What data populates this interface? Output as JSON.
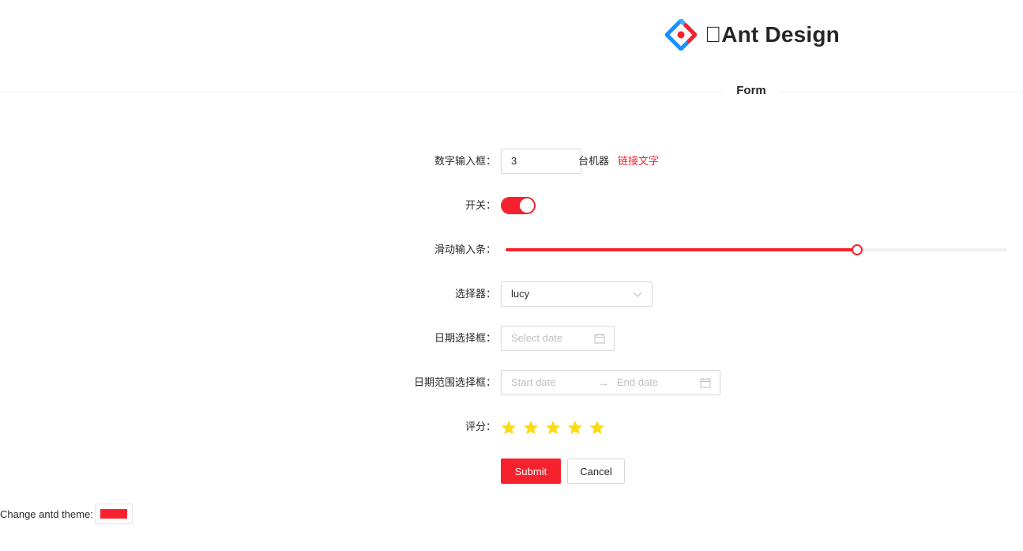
{
  "header": {
    "title": "Ant Design",
    "logo_icon": "ant-design-logo"
  },
  "divider": {
    "title": "Form"
  },
  "form": {
    "number": {
      "label": "数字输入框：",
      "value": "3",
      "suffix": "台机器",
      "link": "链接文字"
    },
    "switch": {
      "label": "开关：",
      "checked": true
    },
    "slider": {
      "label": "滑动输入条：",
      "value_fraction": 0.7
    },
    "select": {
      "label": "选择器：",
      "value": "lucy",
      "icon": "chevron-down-icon"
    },
    "date": {
      "label": "日期选择框：",
      "placeholder": "Select date",
      "icon": "calendar-icon"
    },
    "range": {
      "label": "日期范围选择框：",
      "start_placeholder": "Start date",
      "separator": "→",
      "end_placeholder": "End date",
      "icon": "calendar-icon"
    },
    "rate": {
      "label": "评分：",
      "value": 5,
      "max": 5
    },
    "buttons": {
      "submit": "Submit",
      "cancel": "Cancel"
    }
  },
  "theme": {
    "label": "Change antd theme:",
    "color": "#f5222d"
  },
  "colors": {
    "primary": "#f5222d",
    "star": "#fadb14"
  }
}
